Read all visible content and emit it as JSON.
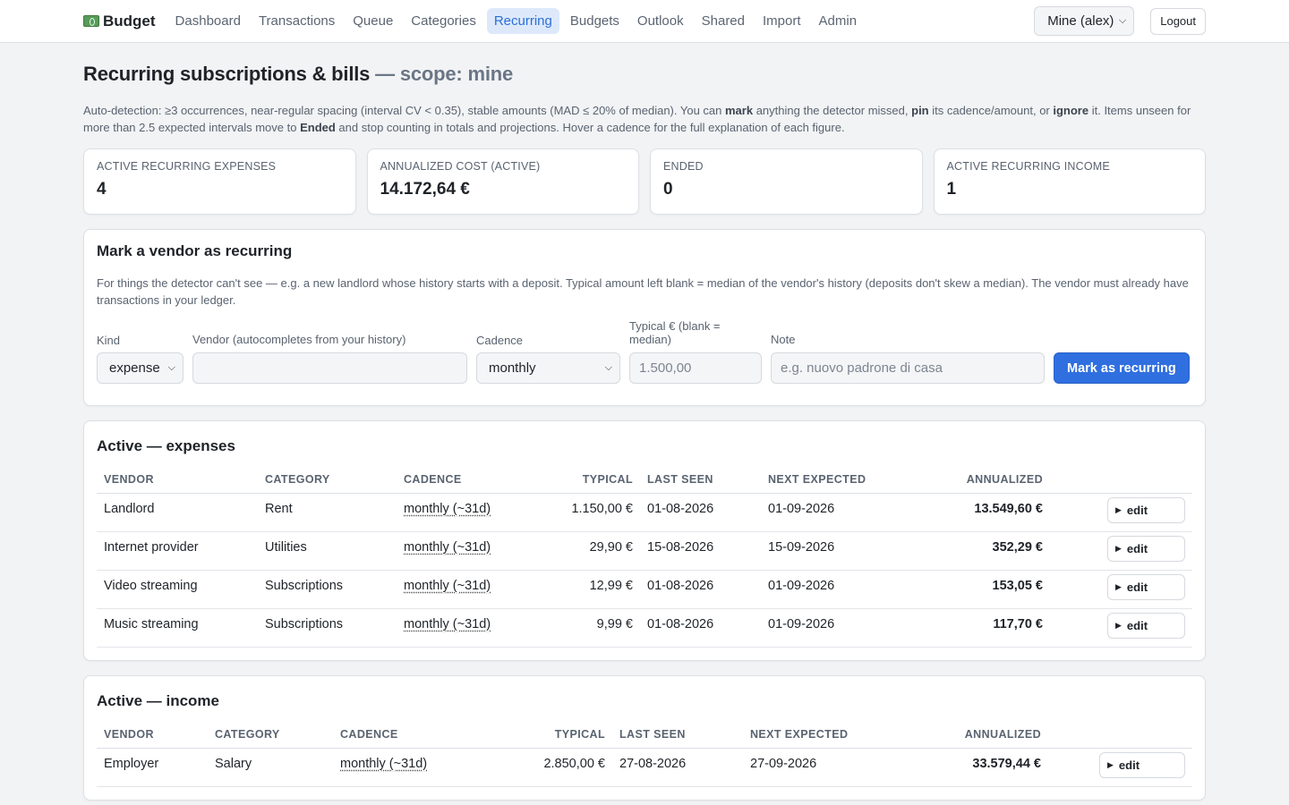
{
  "nav": {
    "brand": "Budget",
    "links": [
      "Dashboard",
      "Transactions",
      "Queue",
      "Categories",
      "Recurring",
      "Budgets",
      "Outlook",
      "Shared",
      "Import",
      "Admin"
    ],
    "active": "Recurring",
    "scope_select": "Mine (alex)",
    "logout": "Logout"
  },
  "page": {
    "title": "Recurring subscriptions & bills",
    "scope_label": "— scope: mine",
    "intro": {
      "p1": "Auto-detection: ≥3 occurrences, near-regular spacing (interval CV < 0.35), stable amounts (MAD ≤ 20% of median). You can ",
      "b1": "mark",
      "p2": " anything the detector missed, ",
      "b2": "pin",
      "p3": " its cadence/amount, or ",
      "b3": "ignore",
      "p4": " it. Items unseen for more than 2.5 expected intervals move to ",
      "b4": "Ended",
      "p5": " and stop counting in totals and projections. Hover a cadence for the full explanation of each figure."
    }
  },
  "stats": [
    {
      "label": "ACTIVE RECURRING EXPENSES",
      "value": "4"
    },
    {
      "label": "ANNUALIZED COST (ACTIVE)",
      "value": "14.172,64 €"
    },
    {
      "label": "ENDED",
      "value": "0"
    },
    {
      "label": "ACTIVE RECURRING INCOME",
      "value": "1"
    }
  ],
  "mark_form": {
    "title": "Mark a vendor as recurring",
    "description": "For things the detector can't see — e.g. a new landlord whose history starts with a deposit. Typical amount left blank = median of the vendor's history (deposits don't skew a median). The vendor must already have transactions in your ledger.",
    "kind_label": "Kind",
    "kind_value": "expense",
    "vendor_label": "Vendor (autocompletes from your history)",
    "vendor_value": "",
    "cadence_label": "Cadence",
    "cadence_value": "monthly",
    "typical_label": "Typical € (blank = median)",
    "typical_placeholder": "1.500,00",
    "note_label": "Note",
    "note_placeholder": "e.g. nuovo padrone di casa",
    "submit": "Mark as recurring"
  },
  "expenses": {
    "title": "Active — expenses",
    "columns": [
      "VENDOR",
      "CATEGORY",
      "CADENCE",
      "TYPICAL",
      "LAST SEEN",
      "NEXT EXPECTED",
      "ANNUALIZED"
    ],
    "rows": [
      {
        "vendor": "Landlord",
        "category": "Rent",
        "cadence": "monthly (~31d)",
        "typical": "1.150,00 €",
        "last_seen": "01-08-2026",
        "next": "01-09-2026",
        "annualized": "13.549,60 €"
      },
      {
        "vendor": "Internet provider",
        "category": "Utilities",
        "cadence": "monthly (~31d)",
        "typical": "29,90 €",
        "last_seen": "15-08-2026",
        "next": "15-09-2026",
        "annualized": "352,29 €"
      },
      {
        "vendor": "Video streaming",
        "category": "Subscriptions",
        "cadence": "monthly (~31d)",
        "typical": "12,99 €",
        "last_seen": "01-08-2026",
        "next": "01-09-2026",
        "annualized": "153,05 €"
      },
      {
        "vendor": "Music streaming",
        "category": "Subscriptions",
        "cadence": "monthly (~31d)",
        "typical": "9,99 €",
        "last_seen": "01-08-2026",
        "next": "01-09-2026",
        "annualized": "117,70 €"
      }
    ],
    "edit_label": "edit"
  },
  "income": {
    "title": "Active — income",
    "columns": [
      "VENDOR",
      "CATEGORY",
      "CADENCE",
      "TYPICAL",
      "LAST SEEN",
      "NEXT EXPECTED",
      "ANNUALIZED"
    ],
    "rows": [
      {
        "vendor": "Employer",
        "category": "Salary",
        "cadence": "monthly (~31d)",
        "typical": "2.850,00 €",
        "last_seen": "27-08-2026",
        "next": "27-09-2026",
        "annualized": "33.579,44 €"
      }
    ],
    "edit_label": "edit"
  }
}
